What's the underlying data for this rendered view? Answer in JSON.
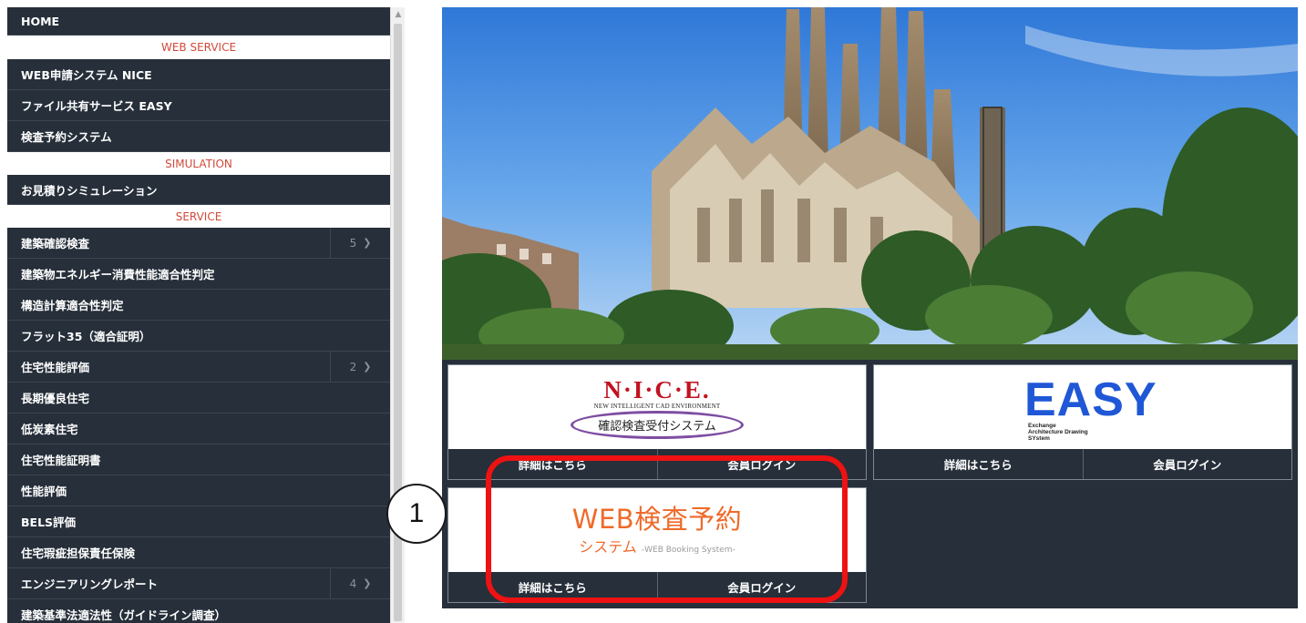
{
  "sidebar": {
    "items": [
      {
        "type": "item",
        "label": "HOME"
      },
      {
        "type": "section",
        "label": "WEB SERVICE"
      },
      {
        "type": "item",
        "label": "WEB申請システム NICE"
      },
      {
        "type": "item",
        "label": "ファイル共有サービス EASY"
      },
      {
        "type": "item",
        "label": "検査予約システム"
      },
      {
        "type": "section",
        "label": "SIMULATION"
      },
      {
        "type": "item",
        "label": "お見積りシミュレーション"
      },
      {
        "type": "section",
        "label": "SERVICE"
      },
      {
        "type": "item",
        "label": "建築確認検査",
        "count": "5"
      },
      {
        "type": "item",
        "label": "建築物エネルギー消費性能適合性判定"
      },
      {
        "type": "item",
        "label": "構造計算適合性判定"
      },
      {
        "type": "item",
        "label": "フラット35（適合証明）"
      },
      {
        "type": "item",
        "label": "住宅性能評価",
        "count": "2"
      },
      {
        "type": "item",
        "label": "長期優良住宅"
      },
      {
        "type": "item",
        "label": "低炭素住宅"
      },
      {
        "type": "item",
        "label": "住宅性能証明書"
      },
      {
        "type": "item",
        "label": "性能評価"
      },
      {
        "type": "item",
        "label": "BELS評価"
      },
      {
        "type": "item",
        "label": "住宅瑕疵担保責任保険"
      },
      {
        "type": "item",
        "label": "エンジニアリングレポート",
        "count": "4"
      },
      {
        "type": "item",
        "label": "建築基準法適法性（ガイドライン調査）"
      }
    ]
  },
  "cards": {
    "nice": {
      "logo_mark": "N·I·C·E.",
      "logo_sub": "NEW INTELLIGENT CAD ENVIRONMENT",
      "logo_caption": "確認検査受付システム",
      "detail_label": "詳細はこちら",
      "login_label": "会員ログイン"
    },
    "easy": {
      "logo_mark": "EASY",
      "logo_sub_1": "Exchange",
      "logo_sub_2": "Architecture Drawing",
      "logo_sub_3": "SYstem",
      "detail_label": "詳細はこちら",
      "login_label": "会員ログイン"
    },
    "web_booking": {
      "logo_title": "WEB検査予約",
      "logo_sub": "システム",
      "logo_sub_en": "-WEB Booking System-",
      "detail_label": "詳細はこちら",
      "login_label": "会員ログイン"
    }
  },
  "annotation": {
    "number": "1",
    "highlight_color": "#ee1212"
  },
  "icons": {
    "chevron": "chevron-right-icon",
    "scroll_up": "scroll-up-arrow-icon"
  },
  "colors": {
    "sidebar_bg": "#262f3a",
    "section_text": "#d04a3a",
    "nice_red": "#c2121f",
    "nice_purple": "#7e4ea2",
    "easy_blue": "#1f57d6",
    "booking_orange": "#ef6a2a"
  }
}
